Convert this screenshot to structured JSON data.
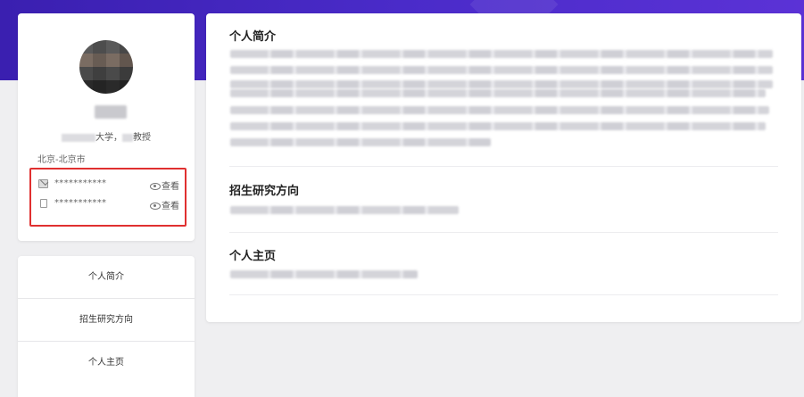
{
  "profile": {
    "title_suffix_1": "大学，",
    "title_suffix_2": "教授",
    "location": "北京-北京市",
    "email_masked": "***********",
    "phone_masked": "***********",
    "view_label": "查看"
  },
  "nav": {
    "items": [
      "个人简介",
      "招生研究方向",
      "个人主页"
    ]
  },
  "main": {
    "sections": [
      {
        "title": "个人简介"
      },
      {
        "title": "招生研究方向"
      },
      {
        "title": "个人主页"
      }
    ]
  },
  "colors": {
    "banner": "#4a2bc9",
    "highlight_border": "#e03030",
    "background": "#efeff1"
  }
}
